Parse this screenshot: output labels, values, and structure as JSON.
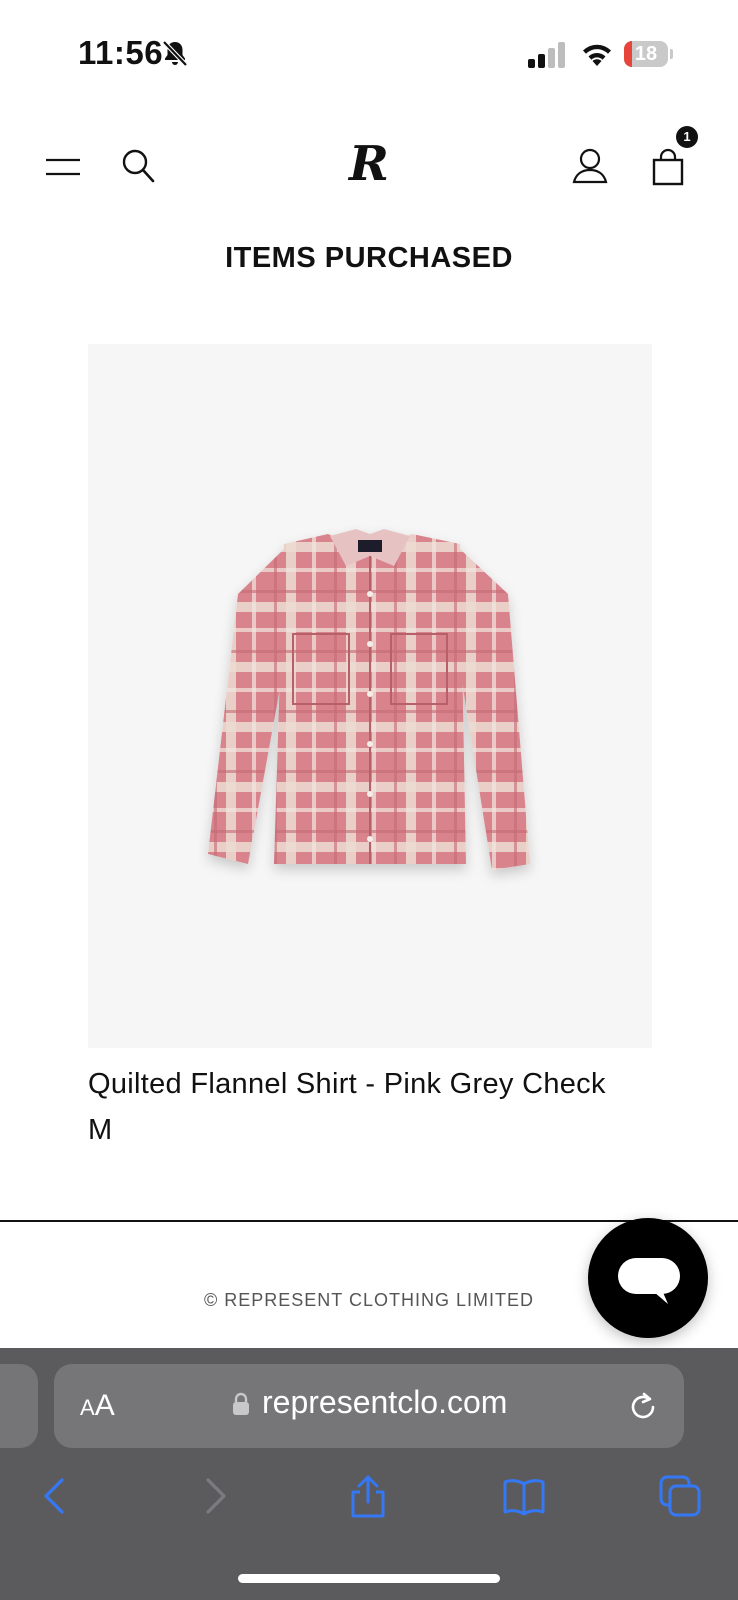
{
  "status_bar": {
    "time": "11:56",
    "battery_level": "18",
    "battery_fraction": 0.18
  },
  "header": {
    "logo": "R",
    "cart_count": "1",
    "icons": [
      "menu-icon",
      "search-icon",
      "account-icon",
      "bag-icon"
    ]
  },
  "page": {
    "title": "ITEMS PURCHASED"
  },
  "product": {
    "name": "Quilted Flannel Shirt - Pink Grey Check",
    "size": "M",
    "image_label": "flannel-shirt-image"
  },
  "footer": {
    "copyright": "© REPRESENT CLOTHING LIMITED"
  },
  "browser": {
    "text_size_label_small": "A",
    "text_size_label_large": "A",
    "url": "representclo.com",
    "accent_color": "#3478f6"
  },
  "colors": {
    "brand": "#111111",
    "shirt_pink": "#d9848c",
    "shirt_cream": "#e8ddd2",
    "battery_low": "#e5453a"
  }
}
